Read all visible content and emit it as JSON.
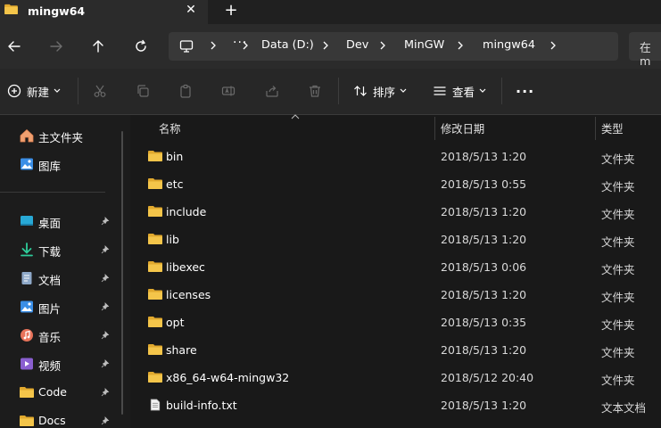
{
  "tab": {
    "title": "mingw64",
    "close_glyph": "✕",
    "new_tab_glyph": "+"
  },
  "address": {
    "segments": [
      "Data (D:)",
      "Dev",
      "MinGW",
      "mingw64"
    ],
    "more_glyph": "···",
    "search_text": "在 m"
  },
  "toolbar": {
    "new_label": "新建",
    "sort_label": "排序",
    "view_label": "查看",
    "more_glyph": "···"
  },
  "sidebar": {
    "top_items": [
      {
        "label": "主文件夹",
        "icon": "home-icon"
      },
      {
        "label": "图库",
        "icon": "gallery-icon"
      }
    ],
    "pinned_items": [
      {
        "label": "桌面",
        "icon": "desktop-icon"
      },
      {
        "label": "下载",
        "icon": "download-icon"
      },
      {
        "label": "文档",
        "icon": "document-icon"
      },
      {
        "label": "图片",
        "icon": "pictures-icon"
      },
      {
        "label": "音乐",
        "icon": "music-icon"
      },
      {
        "label": "视频",
        "icon": "video-icon"
      },
      {
        "label": "Code",
        "icon": "folder-icon"
      },
      {
        "label": "Docs",
        "icon": "folder-icon"
      }
    ]
  },
  "columns": {
    "name": "名称",
    "date": "修改日期",
    "type": "类型"
  },
  "files": [
    {
      "name": "bin",
      "date": "2018/5/13 1:20",
      "type": "文件夹",
      "icon": "folder-icon"
    },
    {
      "name": "etc",
      "date": "2018/5/13 0:55",
      "type": "文件夹",
      "icon": "folder-icon"
    },
    {
      "name": "include",
      "date": "2018/5/13 1:20",
      "type": "文件夹",
      "icon": "folder-icon"
    },
    {
      "name": "lib",
      "date": "2018/5/13 1:20",
      "type": "文件夹",
      "icon": "folder-icon"
    },
    {
      "name": "libexec",
      "date": "2018/5/13 0:06",
      "type": "文件夹",
      "icon": "folder-icon"
    },
    {
      "name": "licenses",
      "date": "2018/5/13 1:20",
      "type": "文件夹",
      "icon": "folder-icon"
    },
    {
      "name": "opt",
      "date": "2018/5/13 0:35",
      "type": "文件夹",
      "icon": "folder-icon"
    },
    {
      "name": "share",
      "date": "2018/5/13 1:20",
      "type": "文件夹",
      "icon": "folder-icon"
    },
    {
      "name": "x86_64-w64-mingw32",
      "date": "2018/5/12 20:40",
      "type": "文件夹",
      "icon": "folder-icon"
    },
    {
      "name": "build-info.txt",
      "date": "2018/5/13 1:20",
      "type": "文本文档",
      "icon": "text-file-icon"
    }
  ],
  "colors": {
    "folder": "#f4c54a",
    "folder_dark": "#e1a92e",
    "accent": "#4cc2ff"
  }
}
